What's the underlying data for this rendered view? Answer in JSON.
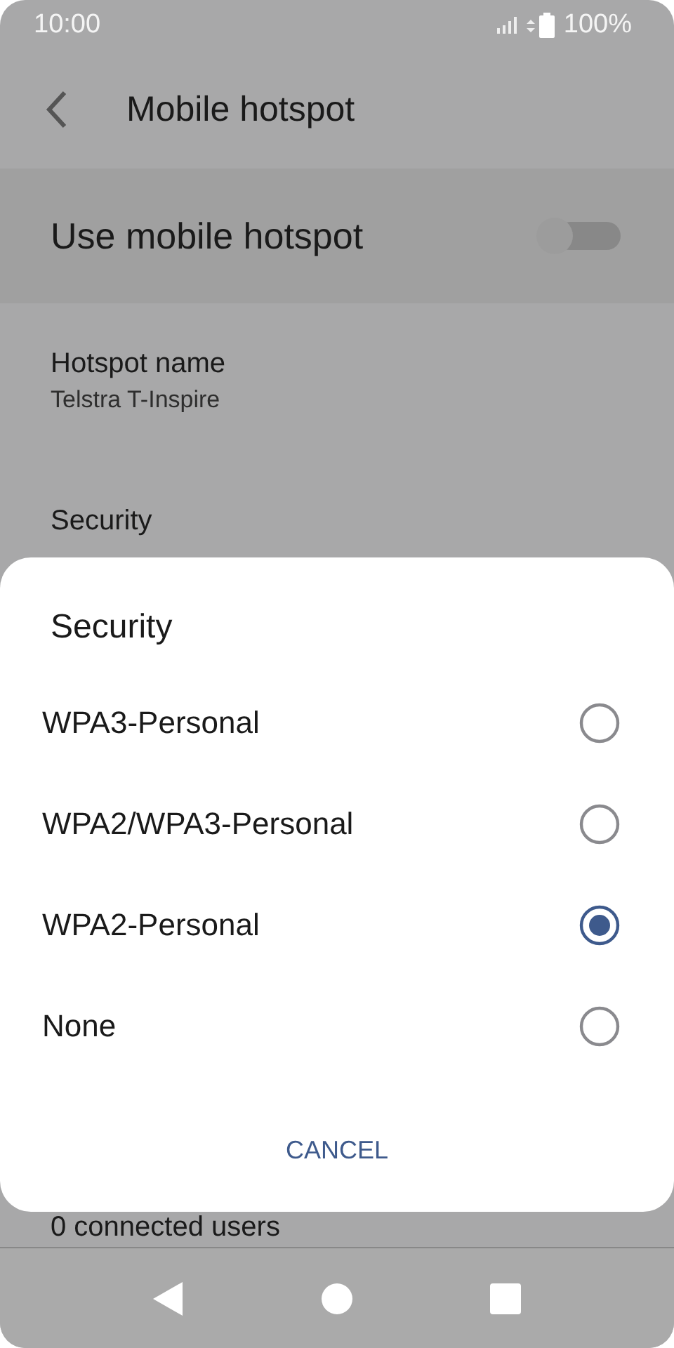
{
  "status_bar": {
    "time": "10:00",
    "battery": "100%"
  },
  "app_bar": {
    "title": "Mobile hotspot"
  },
  "toggle": {
    "label": "Use mobile hotspot",
    "on": false
  },
  "settings": [
    {
      "title": "Hotspot name",
      "value": "Telstra T-Inspire"
    },
    {
      "title": "Security"
    }
  ],
  "footer_text": "0 connected users",
  "dialog": {
    "title": "Security",
    "options": [
      {
        "label": "WPA3-Personal",
        "selected": false
      },
      {
        "label": "WPA2/WPA3-Personal",
        "selected": false
      },
      {
        "label": "WPA2-Personal",
        "selected": true
      },
      {
        "label": "None",
        "selected": false
      }
    ],
    "cancel": "CANCEL"
  }
}
